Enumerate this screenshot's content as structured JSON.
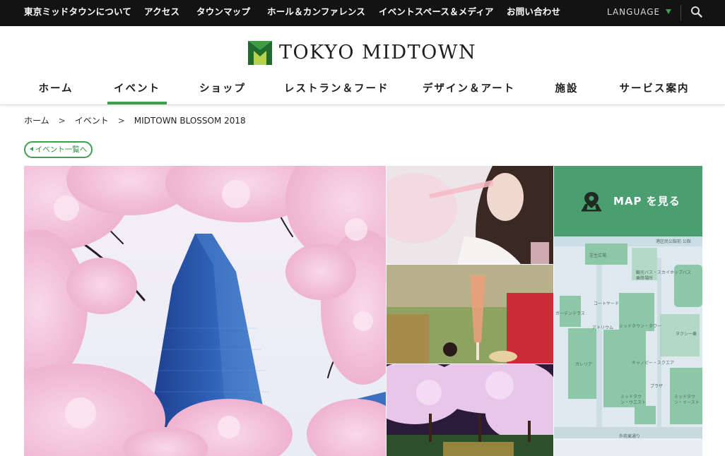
{
  "header": {
    "top_links": [
      "東京ミッドタウンについて",
      "アクセス",
      "タウンマップ",
      "ホール＆カンファレンス",
      "イベントスペース＆メディア",
      "お問い合わせ"
    ],
    "language_label": "LANGUAGE",
    "search_icon": "search-icon",
    "logo_text": "TOKYO MIDTOWN"
  },
  "nav": {
    "items": [
      "ホーム",
      "イベント",
      "ショップ",
      "レストラン＆フード",
      "デザイン＆アート",
      "施設",
      "サービス案内"
    ],
    "active": "イベント"
  },
  "breadcrumb": [
    "ホーム",
    "イベント",
    "MIDTOWN BLOSSOM 2018"
  ],
  "breadcrumb_sep": ">",
  "back_button": "イベント一覧へ",
  "map_cta": {
    "label": "MAP を見る",
    "icon": "map-pin-icon"
  },
  "map_labels": [
    "港区民公館前 公館",
    "芝生広場",
    "観光バス・スカイホップバス乗降場所",
    "コートヤード",
    "ガーデンテラス",
    "アトリウム",
    "ミッドタウン・タワー",
    "タクシー乗",
    "ガレリア",
    "キャノピー・スクエア",
    "プラザ",
    "ミッドタウン・ウエスト",
    "ミッドタウン・イースト",
    "外苑東通り"
  ],
  "colors": {
    "accent": "#3ea04f",
    "map_cta_bg": "#4a9e6f",
    "topbar_bg": "#131313",
    "map_block": "#8cc8a7"
  }
}
